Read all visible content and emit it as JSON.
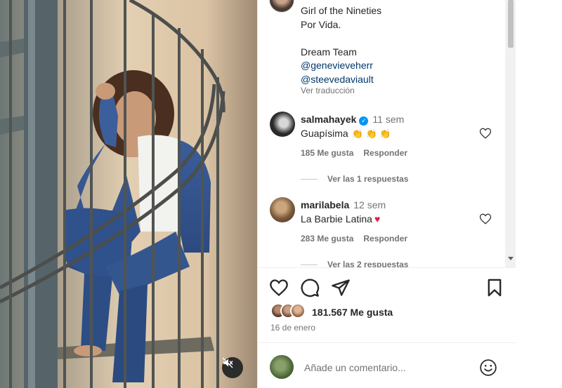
{
  "caption": {
    "lines": [
      "Girl of the Nineties",
      "Por Vida.",
      "",
      "Dream Team"
    ],
    "mentions": [
      "@genevieveherr",
      "@steevedaviault"
    ],
    "see_translation": "Ver traducción"
  },
  "comments": [
    {
      "user": "salmahayek",
      "verified": true,
      "time": "11 sem",
      "text": "Guapísima",
      "emoji": "👏 👏 👏",
      "likes": "185 Me gusta",
      "reply": "Responder",
      "replies": "Ver las 1 respuestas"
    },
    {
      "user": "marilabela",
      "verified": false,
      "time": "12 sem",
      "text": "La Barbie Latina",
      "emoji": "♥",
      "likes": "283 Me gusta",
      "reply": "Responder",
      "replies": "Ver las 2 respuestas"
    }
  ],
  "actions": {
    "like_icon": "heart-outline-icon",
    "comment_icon": "comment-bubble-icon",
    "share_icon": "paper-plane-icon",
    "save_icon": "bookmark-icon"
  },
  "likes_count": "181.567 Me gusta",
  "post_date": "16 de enero",
  "comment_box": {
    "placeholder": "Añade un comentario...",
    "emoji_icon": "smiley-icon"
  },
  "media": {
    "mute_icon": "speaker-muted-icon"
  },
  "colors": {
    "text": "#262626",
    "secondary": "#737373",
    "link": "#00376b",
    "verified": "#0095f6",
    "heart_red": "#e11d48"
  }
}
